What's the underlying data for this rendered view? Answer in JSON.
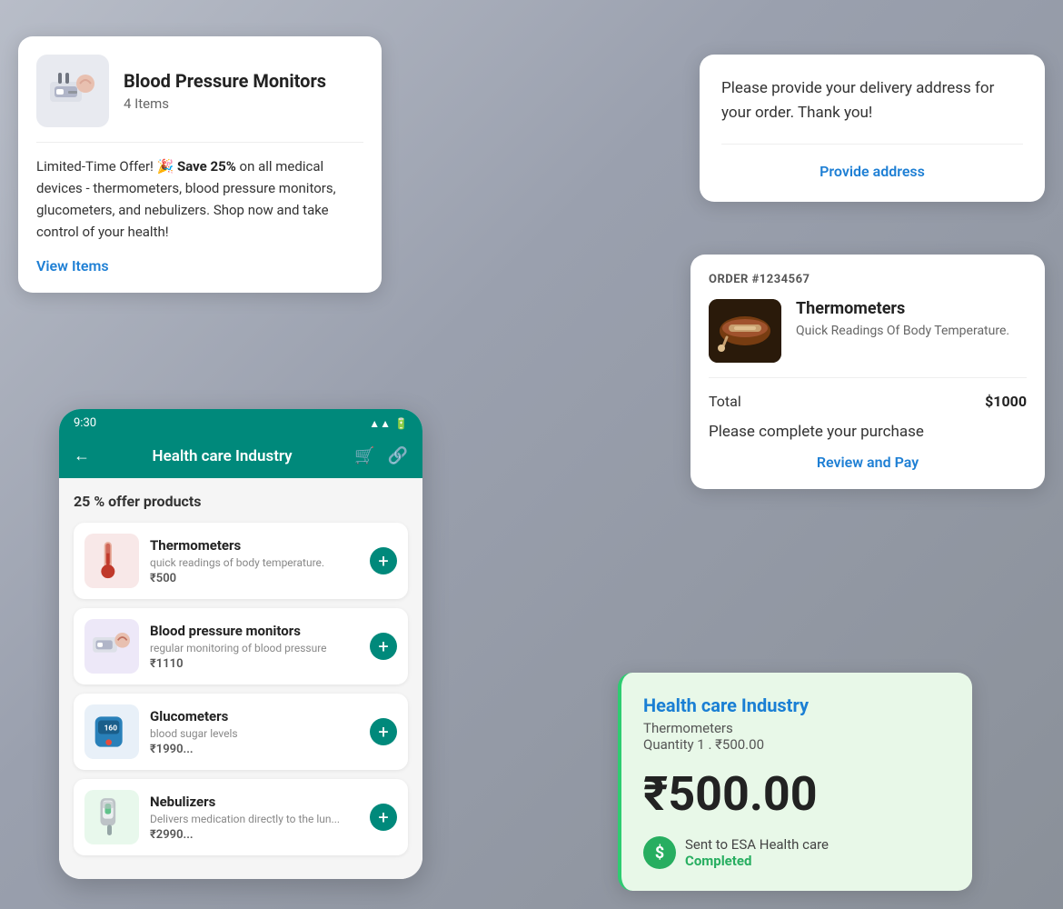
{
  "background": {
    "color": "#c0c5d0"
  },
  "card_blood_pressure": {
    "title": "Blood Pressure Monitors",
    "items_count": "4 Items",
    "offer_text_prefix": "Limited-Time Offer! 🎉 ",
    "offer_bold": "Save 25%",
    "offer_text_suffix": " on all medical devices - thermometers, blood pressure monitors, glucometers, and nebulizers.  Shop now and take control of your health!",
    "view_items_label": "View Items"
  },
  "card_delivery": {
    "message": "Please provide your delivery address for your order. Thank you!",
    "cta_label": "Provide address"
  },
  "card_order": {
    "order_number": "ORDER #1234567",
    "product_name": "Thermometers",
    "product_desc": "Quick Readings Of Body Temperature.",
    "total_label": "Total",
    "total_value": "$1000",
    "complete_text": "Please complete your purchase",
    "cta_label": "Review and Pay"
  },
  "mobile_app": {
    "status_time": "9:30",
    "nav_title": "Health care Industry",
    "offer_banner": "25 % offer products",
    "products": [
      {
        "name": "Thermometers",
        "desc": "quick readings of body temperature.",
        "price": "₹500",
        "color": "#c0392b"
      },
      {
        "name": "Blood pressure monitors",
        "desc": "regular monitoring of blood pressure",
        "price": "₹1110",
        "color": "#8e44ad"
      },
      {
        "name": "Glucometers",
        "desc": "blood sugar levels",
        "price": "₹1990...",
        "color": "#2980b9"
      },
      {
        "name": "Nebulizers",
        "desc": "Delivers medication directly to the lun...",
        "price": "₹2990...",
        "color": "#27ae60"
      }
    ]
  },
  "card_payment": {
    "store_name": "Health care Industry",
    "product_name": "Thermometers",
    "quantity_text": "Quantity 1 . ₹500.00",
    "amount": "₹500.00",
    "sent_to": "Sent to ESA Health care",
    "status": "Completed"
  }
}
